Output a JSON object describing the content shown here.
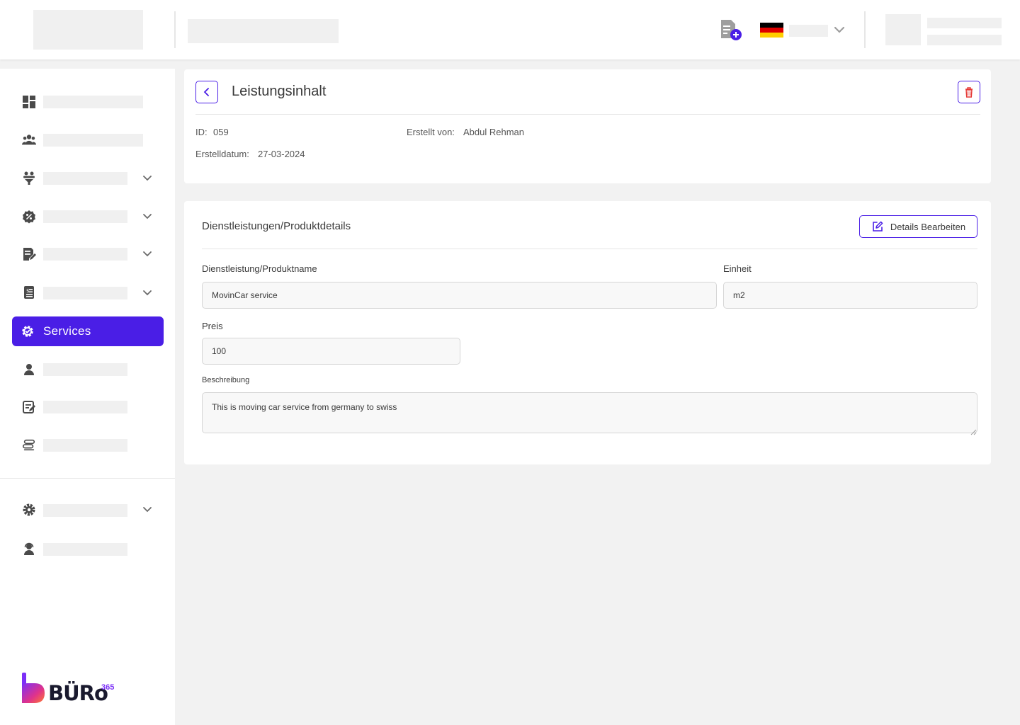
{
  "sidebar": {
    "active_label": "Services",
    "logo_text": "BÜRo",
    "logo_superscript": "365"
  },
  "content": {
    "title": "Leistungsinhalt",
    "id_label": "ID:",
    "id_value": "059",
    "created_by_label": "Erstellt von:",
    "created_by_value": "Abdul Rehman",
    "created_date_label": "Erstelldatum:",
    "created_date_value": "27-03-2024"
  },
  "details": {
    "section_title": "Dienstleistungen/Produktdetails",
    "edit_button_label": "Details Bearbeiten",
    "name_label": "Dienstleistung/Produktname",
    "name_value": "MovinCar service",
    "unit_label": "Einheit",
    "unit_value": "m2",
    "price_label": "Preis",
    "price_value": "100",
    "description_label": "Beschreibung",
    "description_value": "This is moving car service from germany to swiss"
  },
  "colors": {
    "accent": "#4a1ee6",
    "danger": "#e53935",
    "placeholder": "#f0f0f0"
  }
}
